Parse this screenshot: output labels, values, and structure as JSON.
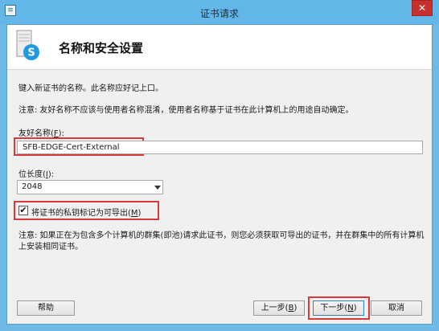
{
  "window": {
    "title": "证书请求",
    "close_glyph": "✕",
    "app_icon": "certificate-app-icon",
    "accent_color": "#63b6e8"
  },
  "header": {
    "title": "名称和安全设置",
    "icon": "skype-server-icon"
  },
  "body": {
    "intro": "键入新证书的名称。此名称应好记上口。",
    "note_friendly_name": "注意: 友好名称不应该与使用者名称混淆，使用者名称基于证书在此计算机上的用途自动确定。"
  },
  "friendly_name": {
    "label": "友好名称(",
    "accesskey": "F",
    "label_end": "):",
    "value": "SFB-EDGE-Cert-External"
  },
  "bit_length": {
    "label": "位长度(",
    "accesskey": "I",
    "label_end": "):",
    "value": "2048"
  },
  "exportable": {
    "checked": true,
    "check_glyph": "✔",
    "label": "将证书的私钥标记为可导出(",
    "accesskey": "M",
    "label_end": ")"
  },
  "note_cluster": "注意: 如果正在为包含多个计算机的群集(即池)请求此证书，则您必须获取可导出的证书，并在群集中的所有计算机上安装相同证书。",
  "buttons": {
    "help": "帮助",
    "back": "上一步(",
    "back_accesskey": "B",
    "back_end": ")",
    "next": "下一步(",
    "next_accesskey": "N",
    "next_end": ")",
    "cancel": "取消"
  },
  "highlight_color": "#d63a3a"
}
